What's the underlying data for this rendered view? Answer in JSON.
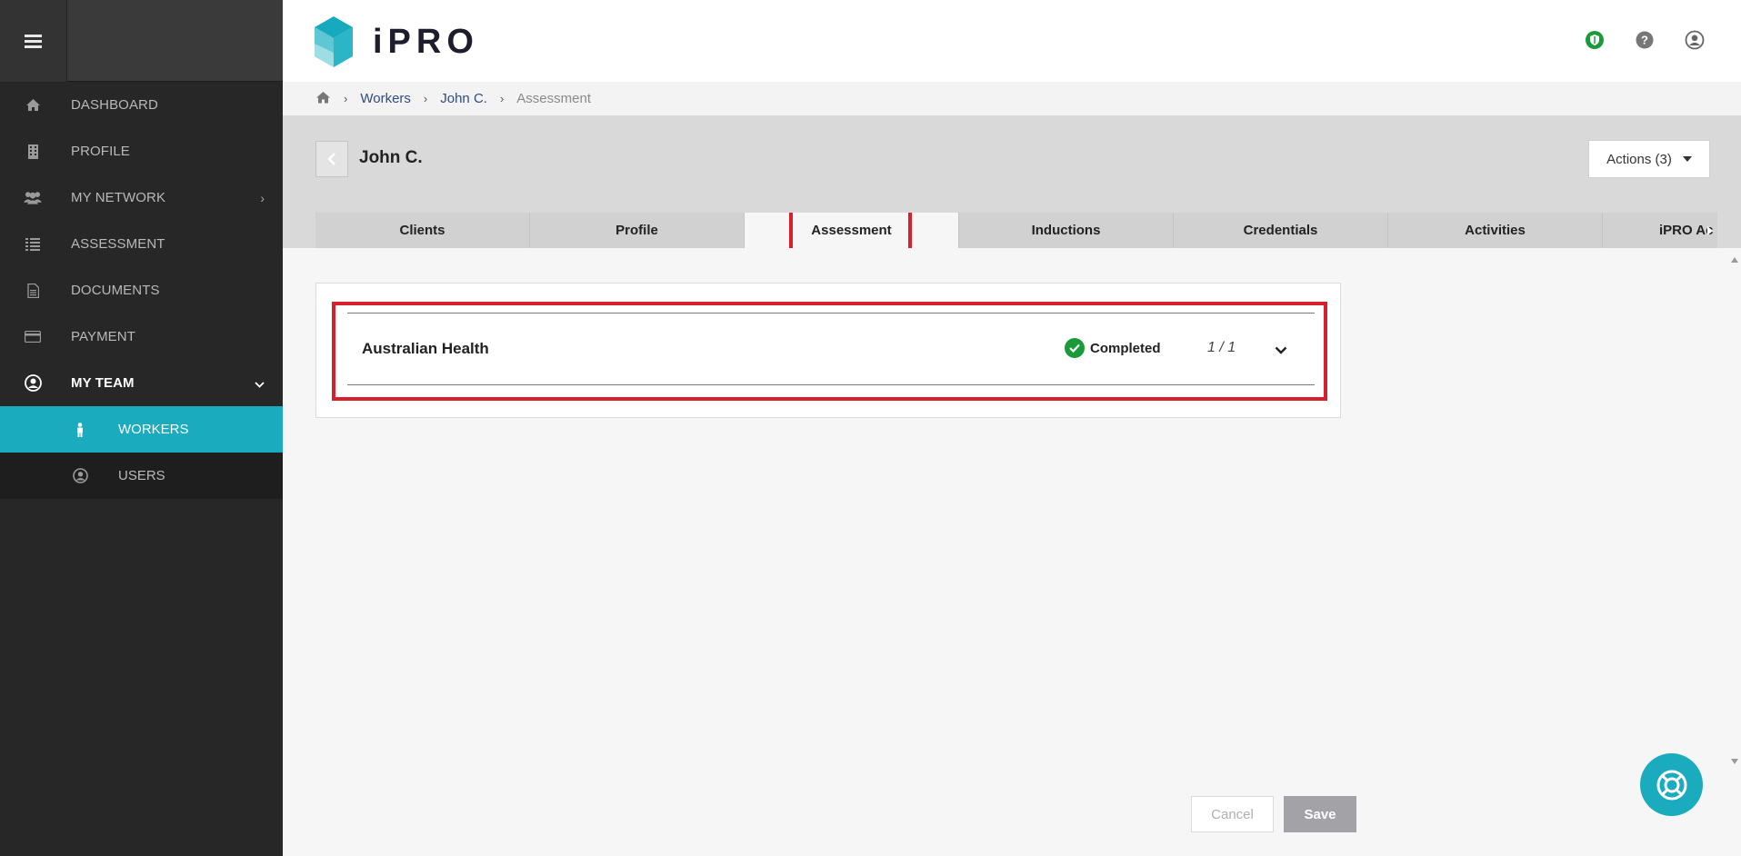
{
  "app": {
    "name": "iPRO"
  },
  "sidebar": {
    "items": [
      {
        "label": "DASHBOARD",
        "icon": "home-icon"
      },
      {
        "label": "PROFILE",
        "icon": "building-icon"
      },
      {
        "label": "MY NETWORK",
        "icon": "users-icon"
      },
      {
        "label": "ASSESSMENT",
        "icon": "list-icon"
      },
      {
        "label": "DOCUMENTS",
        "icon": "document-icon"
      },
      {
        "label": "PAYMENT",
        "icon": "credit-card-icon"
      },
      {
        "label": "MY TEAM",
        "icon": "user-circle-icon"
      }
    ],
    "subitems": [
      {
        "label": "WORKERS",
        "icon": "worker-icon"
      },
      {
        "label": "USERS",
        "icon": "user-circle-icon"
      }
    ]
  },
  "breadcrumb": {
    "workers": "Workers",
    "worker": "John C.",
    "current": "Assessment"
  },
  "page": {
    "title": "John C.",
    "actions_label": "Actions (3)"
  },
  "tabs": [
    "Clients",
    "Profile",
    "Assessment",
    "Inductions",
    "Credentials",
    "Activities",
    "iPRO Ac"
  ],
  "assessment": {
    "title": "Australian Health",
    "status": "Completed",
    "count": "1 / 1"
  },
  "footer": {
    "cancel": "Cancel",
    "save": "Save"
  },
  "colors": {
    "accent": "#1aabbf",
    "sidebar": "#272727",
    "success": "#1b9a3a",
    "highlight": "#d8202d"
  }
}
